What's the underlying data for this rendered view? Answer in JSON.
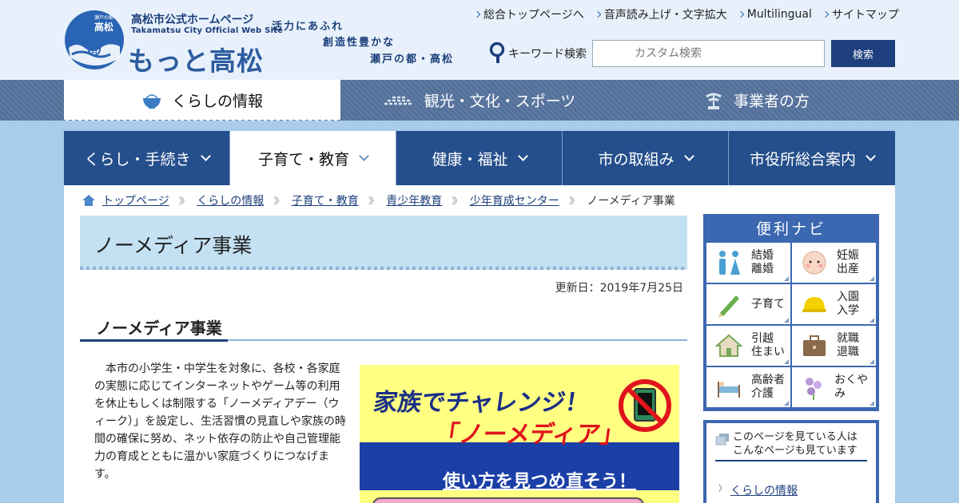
{
  "header": {
    "emblem_top": "瀬戸の都",
    "emblem_name": "高松",
    "site_name_jp": "高松市公式ホームページ",
    "site_name_en": "Takamatsu City Official Web Site",
    "catchphrase": "もっと高松",
    "slogan": [
      "活力にあふれ",
      "創造性豊かな",
      "瀬戸の都・高松"
    ],
    "top_links": [
      "総合トップページへ",
      "音声読み上げ・文字拡大",
      "Multilingual",
      "サイトマップ"
    ],
    "search": {
      "label": "キーワード検索",
      "placeholder": "カスタム検索",
      "button": "検索"
    }
  },
  "categories": [
    {
      "label": "くらしの情報",
      "icon": "rice-bowl-icon",
      "active": true
    },
    {
      "label": "観光・文化・スポーツ",
      "icon": "castle-icon",
      "active": false
    },
    {
      "label": "事業者の方",
      "icon": "bonsai-icon",
      "active": false
    }
  ],
  "subnav": [
    {
      "label": "くらし・手続き",
      "active": false
    },
    {
      "label": "子育て・教育",
      "active": true
    },
    {
      "label": "健康・福祉",
      "active": false
    },
    {
      "label": "市の取組み",
      "active": false
    },
    {
      "label": "市役所総合案内",
      "active": false
    }
  ],
  "breadcrumb": {
    "links": [
      "トップページ",
      "くらしの情報",
      "子育て・教育",
      "青少年教育",
      "少年育成センター"
    ],
    "current": "ノーメディア事業"
  },
  "page": {
    "title": "ノーメディア事業",
    "updated": "更新日：2019年7月25日",
    "heading": "ノーメディア事業",
    "body": "本市の小学生・中学生を対象に、各校・各家庭の実態に応じてインターネットやゲーム等の利用を休止もしくは制限する「ノーメディアデー（ウィーク）」を設定し、生活習慣の見直しや家族の時間の確保に努め、ネット依存の防止や自己管理能力の育成とともに温かい家庭づくりにつなげます。"
  },
  "banner": {
    "line1": "家族でチャレンジ！",
    "line2": "「ノーメディア」",
    "line3": "使い方を見つめ直そう！",
    "colors": {
      "yellow": "#ffff82",
      "blue": "#1a3fa6",
      "red": "#e0141c"
    }
  },
  "navi": {
    "title": "便利ナビ",
    "items": [
      {
        "label": "結婚\n離婚",
        "icon": "couple-icon"
      },
      {
        "label": "妊娠\n出産",
        "icon": "baby-icon"
      },
      {
        "label": "子育て",
        "icon": "pencil-icon"
      },
      {
        "label": "入園\n入学",
        "icon": "school-hat-icon"
      },
      {
        "label": "引越\n住まい",
        "icon": "house-icon"
      },
      {
        "label": "就職\n退職",
        "icon": "briefcase-icon"
      },
      {
        "label": "高齢者\n介護",
        "icon": "care-bed-icon"
      },
      {
        "label": "おくやみ",
        "icon": "flower-icon"
      }
    ]
  },
  "related": {
    "heading": "このページを見ている人は\nこんなページも見ています",
    "links": [
      "くらしの情報"
    ]
  },
  "colors": {
    "navy": "#1d3f7e",
    "nav_blue": "#254f8c",
    "title_bg": "#c3e1f2",
    "page_bg": "#a9ccea"
  }
}
